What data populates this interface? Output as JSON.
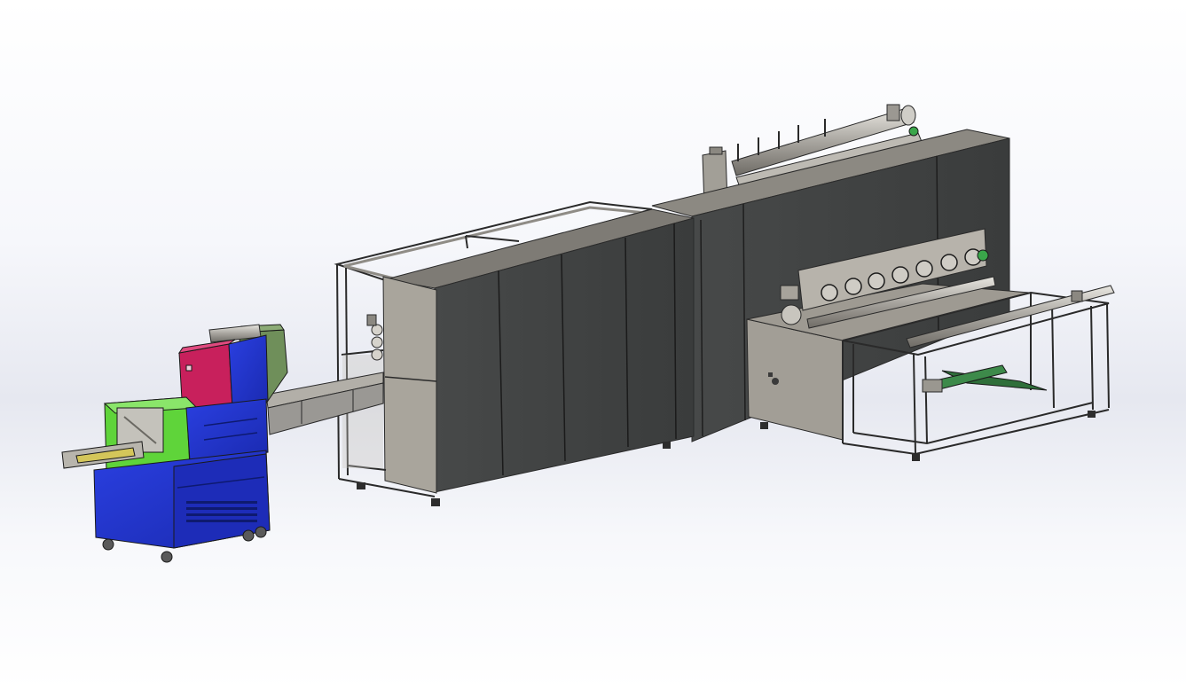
{
  "scene": {
    "subject": "cad-3d-assembly-render",
    "colors": {
      "background_top": "#ffffff",
      "background_mid": "#e6e8f0",
      "cabinet_dark": "#3d3f3f",
      "frame_steel": "#8f8c86",
      "frame_outline": "#2a2a2a",
      "panel_gray": "#a9a59c",
      "packer_blue": "#1e32c8",
      "packer_green": "#5fd43a",
      "packer_magenta": "#c8205c",
      "hopper_olive": "#6f8f5a",
      "conveyor_gray": "#9a9894",
      "green_linkage": "#2f6f3a"
    },
    "icons": {
      "roller": "roller-icon",
      "caster": "caster-wheel-icon",
      "leveling_foot": "leveling-foot-icon"
    }
  }
}
